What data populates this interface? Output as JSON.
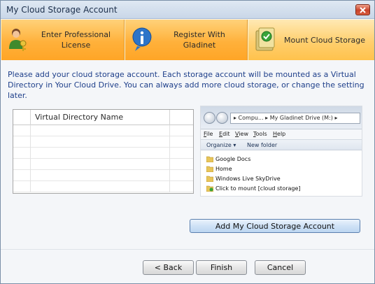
{
  "window": {
    "title": "My Cloud Storage Account"
  },
  "steps": [
    {
      "label_line1": "Enter Professional",
      "label_line2": "License",
      "icon": "user-key-icon"
    },
    {
      "label_line1": "Register With",
      "label_line2": "Gladinet",
      "icon": "info-icon"
    },
    {
      "label_line1": "Mount Cloud Storage",
      "label_line2": "",
      "icon": "mount-folder-icon"
    }
  ],
  "instructions": "Please add your cloud storage account. Each storage account will be mounted as a Virtual Directory in Your Cloud Drive. You can always add more cloud storage, or change the setting later.",
  "grid": {
    "columns": [
      "",
      "Virtual Directory Name",
      ""
    ],
    "rows": [
      [],
      [],
      [],
      [],
      [],
      []
    ]
  },
  "preview": {
    "address": "▸ Compu... ▸ My Gladinet Drive (M:) ▸",
    "menu": [
      "File",
      "Edit",
      "View",
      "Tools",
      "Help"
    ],
    "organize": "Organize ▾",
    "new_folder": "New folder",
    "items": [
      "Google Docs",
      "Home",
      "Windows Live SkyDrive",
      "Click to mount [cloud storage]"
    ]
  },
  "buttons": {
    "add_account": "Add My Cloud Storage Account",
    "back": "< Back",
    "finish": "Finish",
    "cancel": "Cancel"
  },
  "colors": {
    "step_accent": "#ffb13b",
    "text_blue": "#1e3f8a",
    "button_blue": "#cfe2f6"
  }
}
